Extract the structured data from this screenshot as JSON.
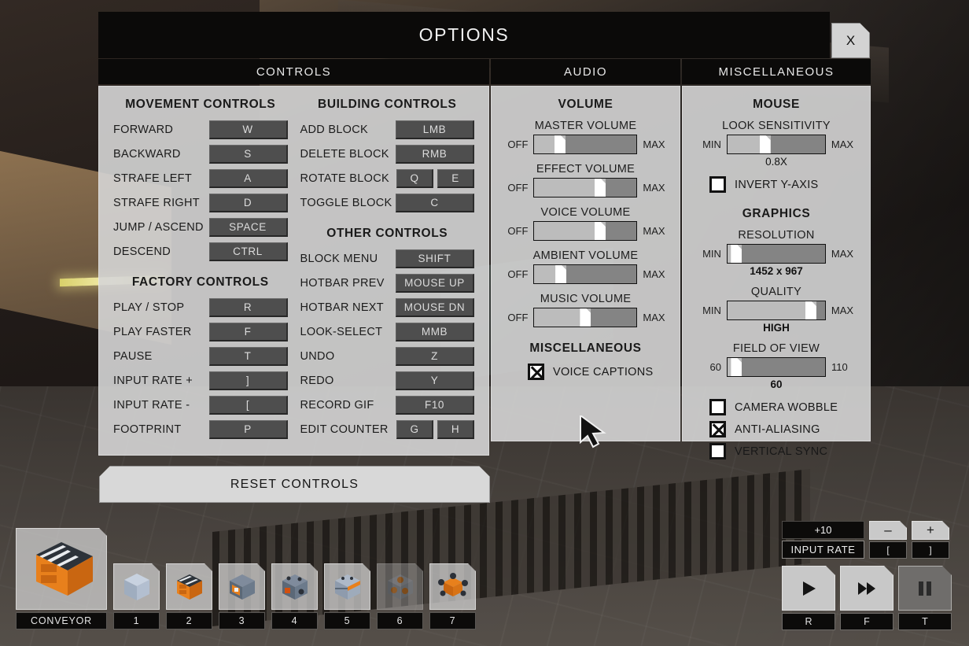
{
  "window": {
    "title": "OPTIONS",
    "close_label": "X"
  },
  "tabs": [
    {
      "label": "CONTROLS"
    },
    {
      "label": "AUDIO"
    },
    {
      "label": "MISCELLANEOUS"
    }
  ],
  "controls": {
    "movement": {
      "heading": "MOVEMENT CONTROLS",
      "rows": [
        {
          "label": "FORWARD",
          "keys": [
            "W"
          ]
        },
        {
          "label": "BACKWARD",
          "keys": [
            "S"
          ]
        },
        {
          "label": "STRAFE LEFT",
          "keys": [
            "A"
          ]
        },
        {
          "label": "STRAFE RIGHT",
          "keys": [
            "D"
          ]
        },
        {
          "label": "JUMP / ASCEND",
          "keys": [
            "SPACE"
          ]
        },
        {
          "label": "DESCEND",
          "keys": [
            "CTRL"
          ]
        }
      ]
    },
    "factory": {
      "heading": "FACTORY CONTROLS",
      "rows": [
        {
          "label": "PLAY / STOP",
          "keys": [
            "R"
          ]
        },
        {
          "label": "PLAY FASTER",
          "keys": [
            "F"
          ]
        },
        {
          "label": "PAUSE",
          "keys": [
            "T"
          ]
        },
        {
          "label": "INPUT RATE +",
          "keys": [
            "]"
          ]
        },
        {
          "label": "INPUT RATE -",
          "keys": [
            "["
          ]
        },
        {
          "label": "FOOTPRINT",
          "keys": [
            "P"
          ]
        }
      ]
    },
    "building": {
      "heading": "BUILDING CONTROLS",
      "rows": [
        {
          "label": "ADD BLOCK",
          "keys": [
            "LMB"
          ]
        },
        {
          "label": "DELETE BLOCK",
          "keys": [
            "RMB"
          ]
        },
        {
          "label": "ROTATE BLOCK",
          "keys": [
            "Q",
            "E"
          ]
        },
        {
          "label": "TOGGLE BLOCK",
          "keys": [
            "C"
          ]
        }
      ]
    },
    "other": {
      "heading": "OTHER CONTROLS",
      "rows": [
        {
          "label": "BLOCK MENU",
          "keys": [
            "SHIFT"
          ]
        },
        {
          "label": "HOTBAR PREV",
          "keys": [
            "MOUSE UP"
          ]
        },
        {
          "label": "HOTBAR NEXT",
          "keys": [
            "MOUSE DN"
          ]
        },
        {
          "label": "LOOK-SELECT",
          "keys": [
            "MMB"
          ]
        },
        {
          "label": "UNDO",
          "keys": [
            "Z"
          ]
        },
        {
          "label": "REDO",
          "keys": [
            "Y"
          ]
        },
        {
          "label": "RECORD GIF",
          "keys": [
            "F10"
          ]
        },
        {
          "label": "EDIT COUNTER",
          "keys": [
            "G",
            "H"
          ]
        }
      ]
    },
    "reset_label": "RESET CONTROLS"
  },
  "audio": {
    "volume_heading": "VOLUME",
    "sliders": [
      {
        "label": "MASTER VOLUME",
        "min_label": "OFF",
        "max_label": "MAX",
        "percent": 22
      },
      {
        "label": "EFFECT VOLUME",
        "min_label": "OFF",
        "max_label": "MAX",
        "percent": 66
      },
      {
        "label": "VOICE VOLUME",
        "min_label": "OFF",
        "max_label": "MAX",
        "percent": 66
      },
      {
        "label": "AMBIENT VOLUME",
        "min_label": "OFF",
        "max_label": "MAX",
        "percent": 23
      },
      {
        "label": "MUSIC VOLUME",
        "min_label": "OFF",
        "max_label": "MAX",
        "percent": 50
      }
    ],
    "misc_heading": "MISCELLANEOUS",
    "voice_captions": {
      "label": "VOICE CAPTIONS",
      "checked": true
    }
  },
  "misc": {
    "mouse_heading": "MOUSE",
    "look_sensitivity": {
      "label": "LOOK SENSITIVITY",
      "min_label": "MIN",
      "max_label": "MAX",
      "percent": 37,
      "value": "0.8X"
    },
    "invert_y": {
      "label": "INVERT Y-AXIS",
      "checked": false
    },
    "graphics_heading": "GRAPHICS",
    "resolution": {
      "label": "RESOLUTION",
      "min_label": "MIN",
      "max_label": "MAX",
      "percent": 4,
      "value": "1452 x 967"
    },
    "quality": {
      "label": "QUALITY",
      "min_label": "MIN",
      "max_label": "MAX",
      "percent": 90,
      "value": "HIGH"
    },
    "fov": {
      "label": "FIELD OF VIEW",
      "min_label": "60",
      "max_label": "110",
      "percent": 4,
      "value": "60"
    },
    "toggles": [
      {
        "label": "CAMERA WOBBLE",
        "checked": false
      },
      {
        "label": "ANTI-ALIASING",
        "checked": true
      },
      {
        "label": "VERTICAL SYNC",
        "checked": false
      }
    ]
  },
  "hotbar": {
    "slots": [
      {
        "label": "CONVEYOR",
        "icon": "conveyor-block-icon",
        "active": true,
        "dim": false
      },
      {
        "label": "1",
        "icon": "plain-cube-icon",
        "active": false,
        "dim": false
      },
      {
        "label": "2",
        "icon": "conveyor-cube-icon",
        "active": false,
        "dim": false
      },
      {
        "label": "3",
        "icon": "sorter-block-icon",
        "active": false,
        "dim": false
      },
      {
        "label": "4",
        "icon": "machine-block-icon",
        "active": false,
        "dim": false
      },
      {
        "label": "5",
        "icon": "splitter-block-icon",
        "active": false,
        "dim": false
      },
      {
        "label": "6",
        "icon": "locked-block-icon",
        "active": false,
        "dim": true
      },
      {
        "label": "7",
        "icon": "junction-block-icon",
        "active": false,
        "dim": false
      }
    ]
  },
  "hud": {
    "input_rate": {
      "value": "+10",
      "name": "INPUT RATE"
    },
    "decrement": {
      "symbol": "–",
      "key": "["
    },
    "increment": {
      "symbol": "+",
      "key": "]"
    },
    "transport": [
      {
        "icon": "play-icon",
        "key": "R",
        "enabled": true
      },
      {
        "icon": "fast-forward-icon",
        "key": "F",
        "enabled": true
      },
      {
        "icon": "pause-icon",
        "key": "T",
        "enabled": false
      }
    ]
  },
  "colors": {
    "panel": "#d5d5d5",
    "header_bar": "#0b0a09",
    "key_button": "#4e4e4e",
    "slider_handle": "#ffffff",
    "slider_fill": "#848484",
    "accent_orange": "#e8801c"
  }
}
